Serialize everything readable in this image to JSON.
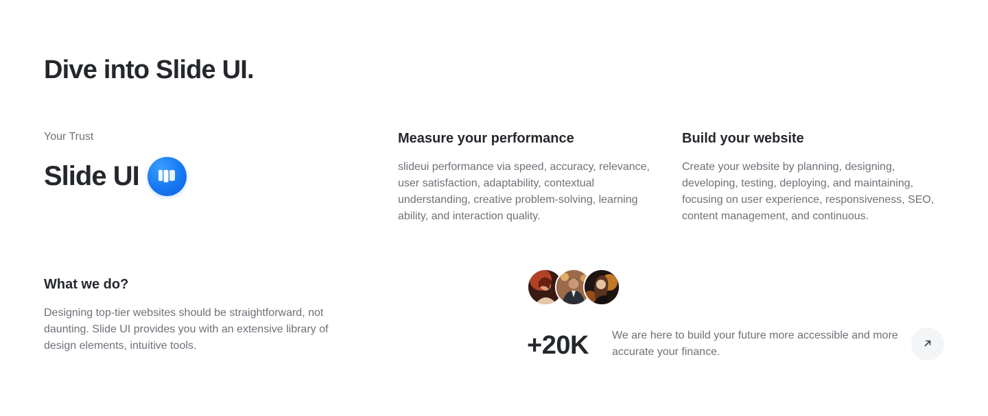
{
  "heading": "Dive into Slide UI.",
  "trust": {
    "label": "Your Trust",
    "brand_name": "Slide UI",
    "logo_icon": "slide-ui-logo-icon",
    "logo_color": "#1677f2"
  },
  "features": [
    {
      "title": "Measure your performance",
      "description": "slideui performance via speed, accuracy, relevance, user satisfaction, adaptability, contextual understanding, creative problem-solving, learning ability, and interaction quality."
    },
    {
      "title": "Build your website",
      "description": "Create your website by planning, designing, developing, testing, deploying, and maintaining, focusing on user experience, responsiveness, SEO, content management, and continuous."
    }
  ],
  "what_we_do": {
    "title": "What we do?",
    "description": "Designing top-tier websites should be straightforward, not daunting. Slide UI provides you with an extensive library of design elements, intuitive tools."
  },
  "stats": {
    "avatars": [
      "avatar-woman-red",
      "avatar-man-suit",
      "avatar-woman-orange"
    ],
    "number": "+20K",
    "text": "We are here to build your future more accessible and more accurate your finance.",
    "arrow_icon": "arrow-up-right-icon"
  }
}
